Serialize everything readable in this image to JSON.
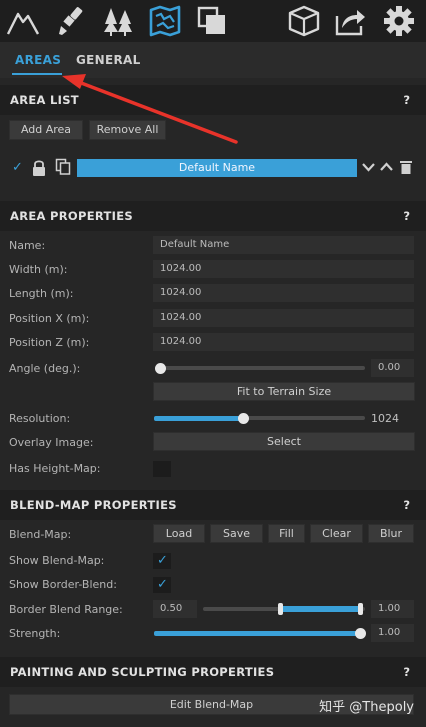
{
  "toolbar": {
    "icons": [
      "mountain-icon",
      "brush-icon",
      "trees-icon",
      "map-icon",
      "layers-icon",
      "box-icon",
      "export-icon",
      "gear-icon"
    ]
  },
  "tabs": [
    {
      "label": "AREAS",
      "active": true
    },
    {
      "label": "GENERAL",
      "active": false
    }
  ],
  "area_list": {
    "title": "AREA LIST",
    "help": "?",
    "add_label": "Add Area",
    "remove_label": "Remove All",
    "item_name": "Default Name"
  },
  "area_properties": {
    "title": "AREA PROPERTIES",
    "help": "?",
    "name_label": "Name:",
    "name_value": "Default Name",
    "width_label": "Width (m):",
    "width_value": "1024.00",
    "length_label": "Length (m):",
    "length_value": "1024.00",
    "posx_label": "Position X (m):",
    "posx_value": "1024.00",
    "posz_label": "Position Z (m):",
    "posz_value": "1024.00",
    "angle_label": "Angle (deg.):",
    "angle_value": "0.00",
    "angle_fraction": 0.0,
    "fit_label": "Fit to Terrain Size",
    "resolution_label": "Resolution:",
    "resolution_value": "1024",
    "resolution_fraction": 0.43,
    "overlay_label": "Overlay Image:",
    "select_label": "Select",
    "heightmap_label": "Has Height-Map:"
  },
  "blend_map": {
    "title": "BLEND-MAP PROPERTIES",
    "help": "?",
    "blendmap_label": "Blend-Map:",
    "buttons": [
      "Load",
      "Save",
      "Fill",
      "Clear",
      "Blur"
    ],
    "show_blend_label": "Show Blend-Map:",
    "show_border_label": "Show Border-Blend:",
    "border_range_label": "Border Blend Range:",
    "border_min": "0.50",
    "border_max": "1.00",
    "strength_label": "Strength:",
    "strength_value": "1.00",
    "strength_fraction": 1.0
  },
  "painting": {
    "title": "PAINTING AND SCULPTING PROPERTIES",
    "help": "?",
    "edit_label": "Edit Blend-Map"
  },
  "watermark": "知乎 @Thepoly",
  "colors": {
    "accent": "#3aa0d8",
    "arrow": "#e8332a"
  }
}
